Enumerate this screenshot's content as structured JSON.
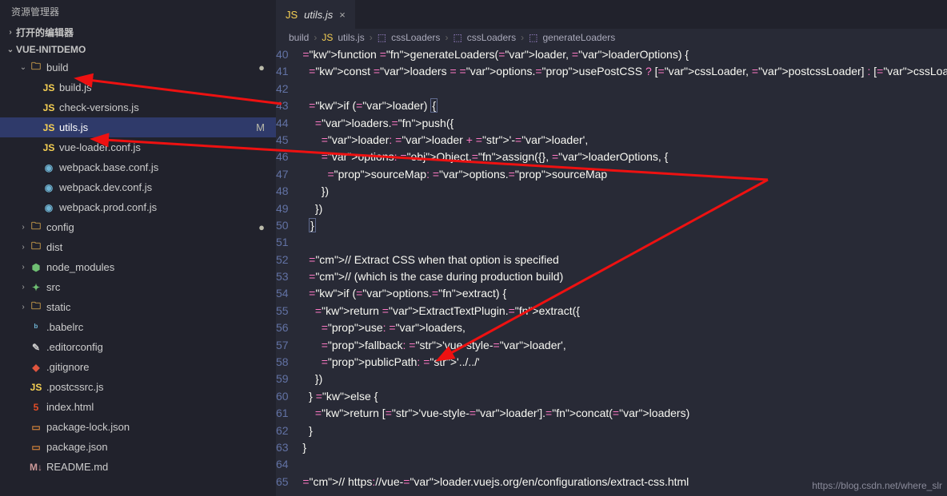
{
  "explorerTitle": "资源管理器",
  "sections": {
    "openEditors": "打开的编辑器",
    "project": "VUE-INITDEMO"
  },
  "tree": [
    {
      "n": "build",
      "t": "folder",
      "c": "down",
      "i": 1,
      "dot": true
    },
    {
      "n": "build.js",
      "t": "js",
      "i": 2
    },
    {
      "n": "check-versions.js",
      "t": "js",
      "i": 2
    },
    {
      "n": "utils.js",
      "t": "js",
      "i": 2,
      "sel": true,
      "status": "M"
    },
    {
      "n": "vue-loader.conf.js",
      "t": "js",
      "i": 2
    },
    {
      "n": "webpack.base.conf.js",
      "t": "cfg",
      "i": 2
    },
    {
      "n": "webpack.dev.conf.js",
      "t": "cfg",
      "i": 2
    },
    {
      "n": "webpack.prod.conf.js",
      "t": "cfg",
      "i": 2
    },
    {
      "n": "config",
      "t": "folder",
      "c": "right",
      "i": 1,
      "dot": true
    },
    {
      "n": "dist",
      "t": "folder",
      "c": "right",
      "i": 1
    },
    {
      "n": "node_modules",
      "t": "nodemod",
      "c": "right",
      "i": 1
    },
    {
      "n": "src",
      "t": "src",
      "c": "right",
      "i": 1
    },
    {
      "n": "static",
      "t": "folder",
      "c": "right",
      "i": 1
    },
    {
      "n": ".babelrc",
      "t": "babel",
      "i": 1
    },
    {
      "n": ".editorconfig",
      "t": "editcfg",
      "i": 1
    },
    {
      "n": ".gitignore",
      "t": "git",
      "i": 1
    },
    {
      "n": ".postcssrc.js",
      "t": "js",
      "i": 1
    },
    {
      "n": "index.html",
      "t": "html",
      "i": 1
    },
    {
      "n": "package-lock.json",
      "t": "pkg",
      "i": 1
    },
    {
      "n": "package.json",
      "t": "pkg",
      "i": 1
    },
    {
      "n": "README.md",
      "t": "md",
      "i": 1
    }
  ],
  "tab": {
    "name": "utils.js"
  },
  "breadcrumb": [
    "build",
    "utils.js",
    "cssLoaders",
    "cssLoaders",
    "generateLoaders"
  ],
  "startLine": 40,
  "lines": [
    "  function generateLoaders(loader, loaderOptions) {",
    "    const loaders = options.usePostCSS ? [cssLoader, postcssLoader] : [cssLoader]",
    "",
    "    if (loader) {",
    "      loaders.push({",
    "        loader: loader + '-loader',",
    "        options: Object.assign({}, loaderOptions, {",
    "          sourceMap: options.sourceMap",
    "        })",
    "      })",
    "    }",
    "",
    "    // Extract CSS when that option is specified",
    "    // (which is the case during production build)",
    "    if (options.extract) {",
    "      return ExtractTextPlugin.extract({",
    "        use: loaders,",
    "        fallback: 'vue-style-loader',",
    "        publicPath: '../../'",
    "      })",
    "    } else {",
    "      return ['vue-style-loader'].concat(loaders)",
    "    }",
    "  }",
    "",
    "  // https://vue-loader.vuejs.org/en/configurations/extract-css.html"
  ],
  "watermark": "https://blog.csdn.net/where_slr"
}
